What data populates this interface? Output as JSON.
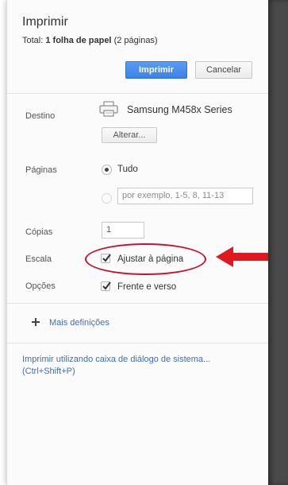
{
  "dialog": {
    "title": "Imprimir",
    "total_prefix": "Total:",
    "total_bold": "1 folha de papel",
    "total_suffix": "(2 páginas)",
    "print_button": "Imprimir",
    "cancel_button": "Cancelar"
  },
  "destination": {
    "label": "Destino",
    "printer_name": "Samsung M458x Series",
    "change_button": "Alterar..."
  },
  "pages": {
    "label": "Páginas",
    "option_all": "Tudo",
    "option_all_selected": true,
    "range_placeholder": "por exemplo, 1-5, 8, 11-13"
  },
  "copies": {
    "label": "Cópias",
    "value": "1"
  },
  "scale": {
    "label": "Escala",
    "fit_to_page_label": "Ajustar à página",
    "fit_to_page_checked": true
  },
  "options": {
    "label": "Opções",
    "duplex_label": "Frente e verso",
    "duplex_checked": true
  },
  "more_settings": {
    "label": "Mais definições",
    "icon": "plus-icon"
  },
  "system_dialog_link": {
    "line1": "Imprimir utilizando caixa de diálogo de sistema...",
    "line2": "(Ctrl+Shift+P)"
  },
  "colors": {
    "accent_blue": "#3d82e6",
    "link_blue": "#3b6ec9",
    "annotation_red": "#c8102e",
    "arrow_red": "#e0191f"
  }
}
